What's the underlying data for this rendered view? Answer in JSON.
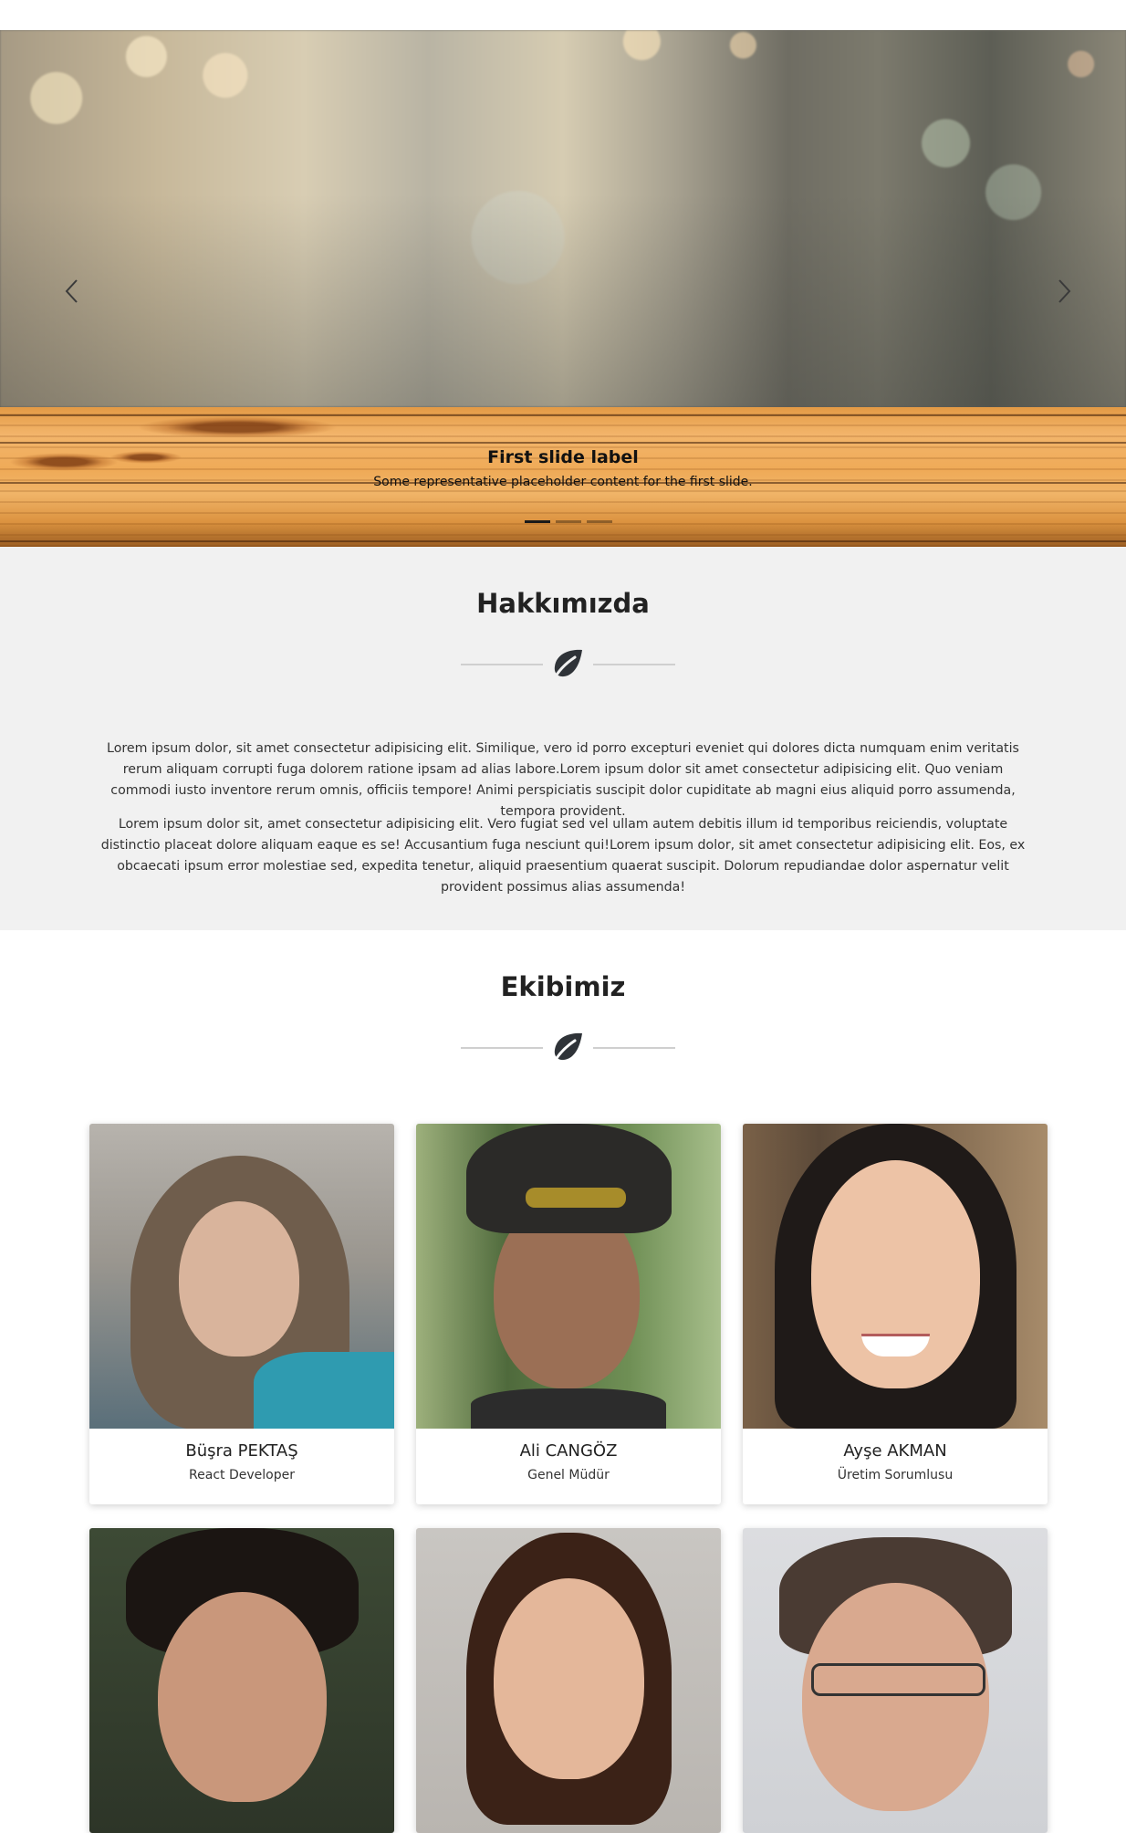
{
  "carousel": {
    "prev_label": "Previous",
    "next_label": "Next",
    "slide": {
      "title": "First slide label",
      "text": "Some representative placeholder content for the first slide."
    },
    "indicators": [
      {
        "label": "Slide 1",
        "active": true
      },
      {
        "label": "Slide 2",
        "active": false
      },
      {
        "label": "Slide 3",
        "active": false
      }
    ]
  },
  "about": {
    "title": "Hakkımızda",
    "paragraphs": [
      "Lorem ipsum dolor, sit amet consectetur adipisicing elit. Similique, vero id porro excepturi eveniet qui dolores dicta numquam enim veritatis rerum aliquam corrupti fuga dolorem ratione ipsam ad alias labore.Lorem ipsum dolor sit amet consectetur adipisicing elit. Quo veniam commodi iusto inventore rerum omnis, officiis tempore! Animi perspiciatis suscipit dolor cupiditate ab magni eius aliquid porro assumenda, tempora provident.",
      "Lorem ipsum dolor sit, amet consectetur adipisicing elit. Vero fugiat sed vel ullam autem debitis illum id temporibus reiciendis, voluptate distinctio placeat dolore aliquam eaque es se! Accusantium fuga nesciunt qui!Lorem ipsum dolor, sit amet consectetur adipisicing elit. Eos, ex obcaecati ipsum error molestiae sed, expedita tenetur, aliquid praesentium quaerat suscipit. Dolorum repudiandae dolor aspernatur velit provident possimus alias assumenda!"
    ]
  },
  "team": {
    "title": "Ekibimiz",
    "members": [
      {
        "name": "Büşra PEKTAŞ",
        "role": "React Developer"
      },
      {
        "name": "Ali CANGÖZ",
        "role": "Genel Müdür"
      },
      {
        "name": "Ayşe AKMAN",
        "role": "Üretim Sorumlusu"
      }
    ]
  },
  "colors": {
    "section_bg": "#f1f1f1",
    "divider_line": "#cfcfcf",
    "icon": "#2f3338"
  },
  "icons": {
    "section_divider": "leaf-icon",
    "carousel_prev": "chevron-left-icon",
    "carousel_next": "chevron-right-icon"
  }
}
